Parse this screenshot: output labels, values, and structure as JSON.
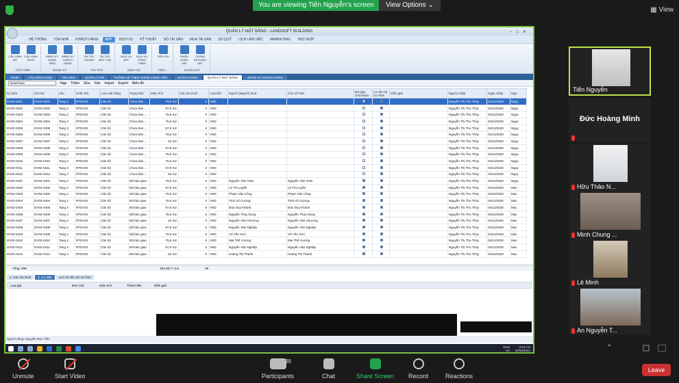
{
  "zoom": {
    "viewing_banner": "You are viewing Tiến Nguyễn's screen",
    "view_options": "View Options",
    "view_button": "View",
    "controls": {
      "unmute": "Unmute",
      "start_video": "Start Video",
      "participants": "Participants",
      "participants_count": "38",
      "chat": "Chat",
      "share_screen": "Share Screen",
      "record": "Record",
      "reactions": "Reactions",
      "leave": "Leave"
    },
    "participants_list": [
      {
        "name": "Tiến Nguyễn"
      },
      {
        "name": "Đức Hoàng Minh"
      },
      {
        "name": "Hữu Thảo N..."
      },
      {
        "name": "Minh Chung ..."
      },
      {
        "name": "Lê Minh"
      },
      {
        "name": "An Nguyễn T..."
      }
    ]
  },
  "app": {
    "title": "QUẢN LÝ MẶT BẰNG - LANDSOFT BUILDING",
    "menu": [
      "HỆ THỐNG",
      "TÒA NHÀ",
      "KHÁCH HÀNG",
      "APP",
      "DỊCH VỤ",
      "KỸ THUẬT",
      "SỔ TÀI SẢN",
      "MUA TÀI SẢN",
      "SỔ QUỸ",
      "LỊCH LÀM VIỆC",
      "MARKETING",
      "TRỢ GIÚP"
    ],
    "ribbon_groups": [
      {
        "label": "CẤU HÌNH",
        "buttons": [
          "CẤU HÌNH API",
          "CẤU HÌNH PAGE"
        ]
      },
      {
        "label": "ĐĂNG KÝ",
        "buttons": [
          "ĐĂNG KÝ NHÂN VIÊN",
          "ĐĂNG KÝ KHÁCH HÀNG"
        ]
      },
      {
        "label": "TIN TỨC",
        "buttons": [
          "TIN TỨC CHUNG",
          "TIN TỨC MỘT TÒA"
        ]
      },
      {
        "label": "DỊCH VỤ",
        "buttons": [
          "DỊCH VỤ APP",
          "DỊCH VỤ CÔNG THÊM"
        ]
      },
      {
        "label": "TIỆN ...",
        "buttons": [
          "TIỆN ÍCH"
        ]
      },
      {
        "label": "KHẢO SÁT",
        "buttons": [
          "PHIẾU KHẢO SÁT",
          "THỐNG KÊ KHẢO SÁT"
        ]
      }
    ],
    "doc_tabs": [
      "MAIN",
      "CẤU HÌNH PAGE",
      "TÒA NHÀ",
      "QUẢN LÝ API",
      "THỐNG KÊ THEO NHÓM CÔNG VIỆC",
      "KHÁCH HÀNG",
      "QUẢN LÝ MẶT BẰNG",
      "ĐĂNG KÝ KHÁCH HÀNG"
    ],
    "toolbar": {
      "building": "RoseTown",
      "buttons": [
        "Nạp",
        "Thêm",
        "Sửa",
        "Xóa",
        "Import",
        "Export",
        "Biểu đồ"
      ]
    },
    "columns": [
      "Ký hiệu",
      "Số nhà",
      "Lầu",
      "Khối nhà",
      "Loại mặt bằng",
      "Trạng thái",
      "Diện tích",
      "Giá cho thuê",
      "Loại tiền",
      "Người (Người) thuê",
      "Chủ sở hữu",
      "Đã giao chìa khóa",
      "Lá căn hộ cá nhân",
      "Diễn giải",
      "Người nhập",
      "Ngày nhập",
      "Ngư"
    ],
    "rows": [
      [
        "DV02-0301",
        "DV02-0301",
        "Tang 3",
        "RTDV02",
        "Căn hộ",
        "Chưa bàn ...",
        "78,8 m2",
        "0",
        "VND",
        "",
        "",
        false,
        true,
        "",
        "Nguyễn Thị Thu Thủy",
        "04/12/2020",
        "Nguy"
      ],
      [
        "DV02-0302",
        "DV02-0302",
        "Tang 3",
        "RTDV02",
        "Căn hộ",
        "Chưa bàn ...",
        "87,9 m2",
        "0",
        "VND",
        "",
        "",
        false,
        true,
        "",
        "Nguyễn Thị Thu Thủy",
        "04/12/2020",
        "Nguy"
      ],
      [
        "DV02-0303",
        "DV02-0303",
        "Tang 3",
        "RTDV02",
        "Căn hộ",
        "Chưa bàn ...",
        "75,6 m2",
        "0",
        "VND",
        "",
        "",
        false,
        true,
        "",
        "Nguyễn Thị Thu Thủy",
        "04/12/2020",
        "Nguy"
      ],
      [
        "DV02-0304",
        "DV02-0304",
        "Tang 3",
        "RTDV02",
        "Căn hộ",
        "Chưa bàn ...",
        "75,6 m2",
        "0",
        "VND",
        "",
        "",
        false,
        true,
        "",
        "Nguyễn Thị Thu Thủy",
        "04/12/2020",
        "Nguy"
      ],
      [
        "DV02-0305",
        "DV02-0305",
        "Tang 3",
        "RTDV02",
        "Căn hộ",
        "Chưa bàn ...",
        "87,9 m2",
        "0",
        "VND",
        "",
        "",
        false,
        true,
        "",
        "Nguyễn Thị Thu Thủy",
        "04/12/2020",
        "Nguy"
      ],
      [
        "DV02-0306",
        "DV02-0306",
        "Tang 3",
        "RTDV02",
        "Căn hộ",
        "Chưa bàn ...",
        "78,8 m2",
        "0",
        "VND",
        "",
        "",
        false,
        true,
        "",
        "Nguyễn Thị Thu Thủy",
        "04/12/2020",
        "Nguy"
      ],
      [
        "DV02-0307",
        "DV02-0307",
        "Tang 3",
        "RTDV02",
        "Căn hộ",
        "Chưa bàn ...",
        "52 m2",
        "0",
        "VND",
        "",
        "",
        false,
        true,
        "",
        "Nguyễn Thị Thu Thủy",
        "04/12/2020",
        "Nguy"
      ],
      [
        "DV02-0308",
        "DV02-0308",
        "Tang 3",
        "RTDV02",
        "Căn hộ",
        "Chưa bàn ...",
        "87,9 m2",
        "0",
        "VND",
        "",
        "",
        false,
        true,
        "",
        "Nguyễn Thị Thu Thủy",
        "04/12/2020",
        "Nguy"
      ],
      [
        "DV02-0309",
        "DV02-0309",
        "Tang 3",
        "RTDV02",
        "Căn hộ",
        "Chưa bàn ...",
        "75,6 m2",
        "0",
        "VND",
        "",
        "",
        false,
        true,
        "",
        "Nguyễn Thị Thu Thủy",
        "04/12/2020",
        "Nguy"
      ],
      [
        "DV02-0310",
        "DV02-0310",
        "Tang 3",
        "RTDV02",
        "Căn hộ",
        "Chưa bàn ...",
        "75,6 m2",
        "0",
        "VND",
        "",
        "",
        false,
        true,
        "",
        "Nguyễn Thị Thu Thủy",
        "04/12/2020",
        "Nguy"
      ],
      [
        "DV02-0311",
        "DV02-0311",
        "Tang 3",
        "RTDV02",
        "Căn hộ",
        "Chưa bàn ...",
        "87,9 m2",
        "0",
        "VND",
        "",
        "",
        false,
        true,
        "",
        "Nguyễn Thị Thu Thủy",
        "04/12/2020",
        "Nguy"
      ],
      [
        "DV02-0312",
        "DV02-0312",
        "Tang 3",
        "RTDV02",
        "Căn hộ",
        "Chưa bàn ...",
        "52 m2",
        "0",
        "VND",
        "",
        "",
        false,
        true,
        "",
        "Nguyễn Thị Thu Thủy",
        "04/12/2020",
        "Nguy"
      ],
      [
        "DV02-0401",
        "DV02-0401",
        "Tang 4",
        "RTDV02",
        "Căn hộ",
        "Đã bàn giao",
        "78,8 m2",
        "0",
        "VND",
        "Nguyễn Văn Toàn",
        "Nguyễn Văn Toàn",
        true,
        true,
        "",
        "Nguyễn Thị Thu Thủy",
        "04/12/2020",
        "Nguy"
      ],
      [
        "DV02-0402",
        "DV02-0402",
        "Tang 4",
        "RTDV02",
        "Căn hộ",
        "Đã bàn giao",
        "87,9 m2",
        "0",
        "VND",
        "Lê Thị Luyến",
        "Lê Thị Luyến",
        true,
        true,
        "",
        "Nguyễn Thị Thu Thủy",
        "04/12/2020",
        "Mac"
      ],
      [
        "DV02-0403",
        "DV02-0403",
        "Tang 4",
        "RTDV02",
        "Căn hộ",
        "Đã bàn giao",
        "75,6 m2",
        "0",
        "VND",
        "Phạm Văn Công",
        "Phạm Văn Công",
        true,
        true,
        "",
        "Nguyễn Thị Thu Thủy",
        "04/12/2020",
        "Mac"
      ],
      [
        "DV02-0404",
        "DV02-0404",
        "Tang 4",
        "RTDV02",
        "Căn hộ",
        "Đã bàn giao",
        "75,6 m2",
        "0",
        "VND",
        "Thái Vũ Cương",
        "Thái Vũ Cương",
        true,
        true,
        "",
        "Nguyễn Thị Thu Thủy",
        "04/12/2020",
        "Mac"
      ],
      [
        "DV02-0405",
        "DV02-0405",
        "Tang 4",
        "RTDV02",
        "Căn hộ",
        "Đã bàn giao",
        "87,9 m2",
        "0",
        "VND",
        "Đào Duy Khánh",
        "Đào Duy Khánh",
        true,
        true,
        "",
        "Nguyễn Thị Thu Thủy",
        "04/12/2020",
        "Mac"
      ],
      [
        "DV02-0406",
        "DV02-0406",
        "Tang 4",
        "RTDV02",
        "Căn hộ",
        "Đã bàn giao",
        "78,8 m2",
        "0",
        "VND",
        "Nguyễn Thúy Dung",
        "Nguyễn Thúy Dung",
        true,
        true,
        "",
        "Nguyễn Thị Thu Thủy",
        "04/12/2020",
        "Mac"
      ],
      [
        "DV02-0407",
        "DV02-0407",
        "Tang 4",
        "RTDV02",
        "Căn hộ",
        "Đã bàn giao",
        "52 m2",
        "0",
        "VND",
        "Nguyễn Văn Chương",
        "Nguyễn Văn Chương",
        true,
        true,
        "",
        "Nguyễn Thị Thu Thủy",
        "04/12/2020",
        "Mac"
      ],
      [
        "DV02-0408",
        "DV02-0408",
        "Tang 4",
        "RTDV02",
        "Căn hộ",
        "Đã bàn giao",
        "87,9 m2",
        "0",
        "VND",
        "Nguyễn Văn Nghiệp",
        "Nguyễn Văn Nghiệp",
        true,
        true,
        "",
        "Nguyễn Thị Thu Thủy",
        "04/12/2020",
        "Mac"
      ],
      [
        "DV02-0409",
        "DV02-0409",
        "Tang 4",
        "RTDV02",
        "Căn hộ",
        "Đã bàn giao",
        "75,6 m2",
        "0",
        "VND",
        "Vũ Yến Sơn",
        "Vũ Yến Sơn",
        true,
        true,
        "",
        "Nguyễn Thị Thu Thủy",
        "04/12/2020",
        "Mac"
      ],
      [
        "DV02-0410",
        "DV02-0410",
        "Tang 4",
        "RTDV02",
        "Căn hộ",
        "Đã bàn giao",
        "75,6 m2",
        "0",
        "VND",
        "Mai Thế Vương",
        "Mai Thế Vương",
        true,
        true,
        "",
        "Nguyễn Thị Thu Thủy",
        "04/12/2020",
        "Mac"
      ],
      [
        "DV02-0411",
        "DV02-0411",
        "Tang 4",
        "RTDV02",
        "Căn hộ",
        "Đã bàn giao",
        "87,9 m2",
        "0",
        "VND",
        "Nguyễn Văn Nghiệp",
        "Nguyễn Văn Nghiệp",
        true,
        true,
        "",
        "Nguyễn Thị Thu Thủy",
        "04/12/2020",
        "Mac"
      ],
      [
        "DV02-0412",
        "DV02-0412",
        "Tang 4",
        "RTDV02",
        "Căn hộ",
        "Đã bàn giao",
        "52 m2",
        "0",
        "VND",
        "Hoàng Thị Thanh",
        "Hoàng Thị Thanh",
        true,
        true,
        "",
        "Nguyễn Thị Thu Thủy",
        "04/12/2020",
        "Mac"
      ]
    ],
    "footer": {
      "total": "Tổng: 299",
      "area_sum": "193.057,7 m2",
      "count": "30"
    },
    "bottom_tabs": [
      "1. Giá cho thuê",
      "2. Cư dân",
      "Lịch sử đổi chủ sở hữu"
    ],
    "subgrid_columns": [
      "Loại giá",
      "Đơn Giá",
      "Diện tích",
      "Thành tiền",
      "Diễn giải"
    ],
    "status": "Người dùng: Nguyễn Đức Tiến",
    "tray_lang": "ENG\nUS",
    "tray_time": "3:53 CH\n20/09/2021"
  }
}
